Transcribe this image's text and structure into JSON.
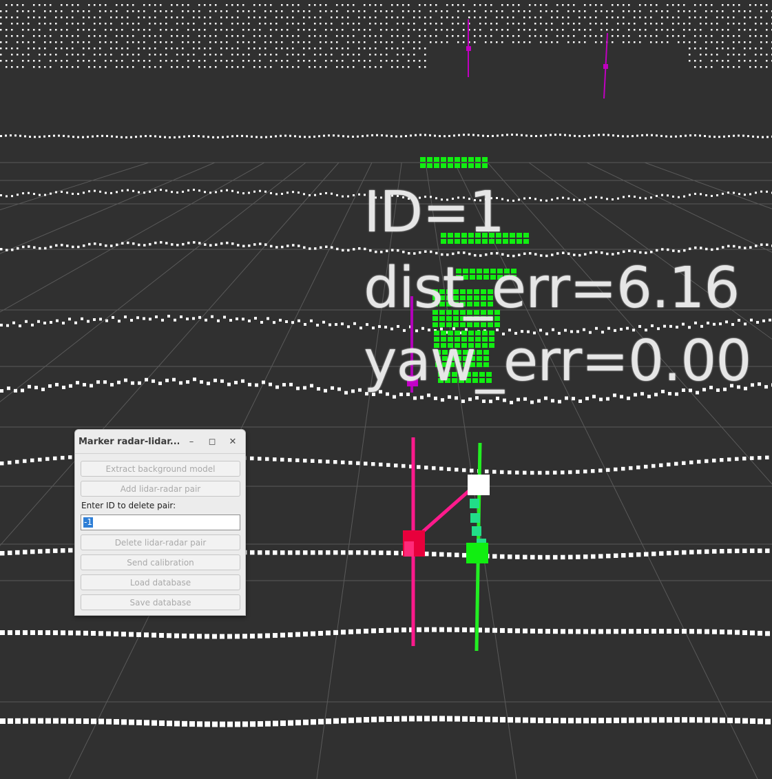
{
  "overlay": {
    "id_text": "ID=1",
    "dist_text": "dist_err=6.16",
    "yaw_text": "yaw_err=0.00"
  },
  "dialog": {
    "title": "Marker radar-lidar...",
    "minimize_icon": "minimize-icon",
    "maximize_icon": "maximize-icon",
    "close_icon": "close-icon",
    "extract_label": "Extract background model",
    "add_pair_label": "Add lidar-radar pair",
    "delete_prompt": "Enter ID to delete pair:",
    "delete_id_value": "-1",
    "delete_pair_label": "Delete lidar-radar pair",
    "send_calibration_label": "Send calibration",
    "load_database_label": "Load database",
    "save_database_label": "Save database"
  },
  "colors": {
    "background": "#303030",
    "grid": "#5a5a5a",
    "lidar_points": "#ffffff",
    "marker_points": "#11ee11",
    "radar_marker": "#ff1a8c",
    "radar_target": "#e8003c",
    "lidar_target": "#ffffff",
    "distant_marker": "#c000c0"
  }
}
